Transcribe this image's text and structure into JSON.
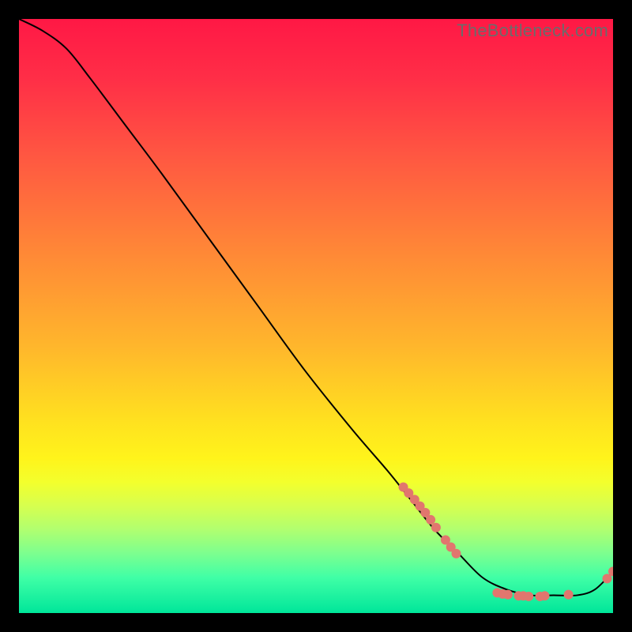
{
  "watermark": "TheBottleneck.com",
  "chart_data": {
    "type": "line",
    "title": "",
    "xlabel": "",
    "ylabel": "",
    "xlim": [
      0,
      100
    ],
    "ylim": [
      0,
      100
    ],
    "grid": false,
    "legend": false,
    "background": {
      "kind": "vertical-gradient",
      "stops": [
        {
          "pct": 0,
          "color": "#ff1845"
        },
        {
          "pct": 10,
          "color": "#ff2e47"
        },
        {
          "pct": 24,
          "color": "#ff5a41"
        },
        {
          "pct": 40,
          "color": "#ff8a36"
        },
        {
          "pct": 55,
          "color": "#ffb62c"
        },
        {
          "pct": 68,
          "color": "#ffe21f"
        },
        {
          "pct": 74,
          "color": "#fff41b"
        },
        {
          "pct": 78,
          "color": "#f3ff2d"
        },
        {
          "pct": 82,
          "color": "#d6ff4f"
        },
        {
          "pct": 86,
          "color": "#b0ff70"
        },
        {
          "pct": 90,
          "color": "#7cff8f"
        },
        {
          "pct": 94,
          "color": "#40ffa6"
        },
        {
          "pct": 100,
          "color": "#00e69a"
        }
      ]
    },
    "series": [
      {
        "name": "bottleneck-curve",
        "color": "#000000",
        "x": [
          0,
          4,
          8,
          12,
          18,
          24,
          32,
          40,
          48,
          56,
          62,
          66,
          70,
          74,
          78,
          82,
          86,
          90,
          94,
          97,
          100
        ],
        "y": [
          100,
          98,
          95,
          90,
          82,
          74,
          63,
          52,
          41,
          31,
          24,
          19,
          14,
          10,
          6,
          4,
          3,
          3,
          3,
          4,
          7
        ]
      }
    ],
    "marker_clusters": [
      {
        "name": "cluster-diagonal",
        "color": "#e1766e",
        "radius": 6,
        "points": [
          {
            "x": 64.7,
            "y": 21.2
          },
          {
            "x": 65.6,
            "y": 20.2
          },
          {
            "x": 66.6,
            "y": 19.1
          },
          {
            "x": 67.5,
            "y": 18.0
          },
          {
            "x": 68.4,
            "y": 16.9
          },
          {
            "x": 69.3,
            "y": 15.7
          },
          {
            "x": 70.2,
            "y": 14.4
          },
          {
            "x": 71.8,
            "y": 12.3
          },
          {
            "x": 72.7,
            "y": 11.1
          },
          {
            "x": 73.6,
            "y": 10.0
          }
        ]
      },
      {
        "name": "cluster-bottom",
        "color": "#e1766e",
        "radius": 6,
        "points": [
          {
            "x": 80.5,
            "y": 3.4
          },
          {
            "x": 81.4,
            "y": 3.2
          },
          {
            "x": 82.3,
            "y": 3.1
          },
          {
            "x": 84.1,
            "y": 2.9
          },
          {
            "x": 84.9,
            "y": 2.9
          },
          {
            "x": 85.8,
            "y": 2.8
          },
          {
            "x": 87.7,
            "y": 2.8
          },
          {
            "x": 88.5,
            "y": 2.9
          },
          {
            "x": 92.5,
            "y": 3.1
          }
        ]
      },
      {
        "name": "cluster-tail",
        "color": "#e1766e",
        "radius": 6,
        "points": [
          {
            "x": 99.0,
            "y": 5.8
          },
          {
            "x": 100.0,
            "y": 7.0
          }
        ]
      }
    ]
  }
}
